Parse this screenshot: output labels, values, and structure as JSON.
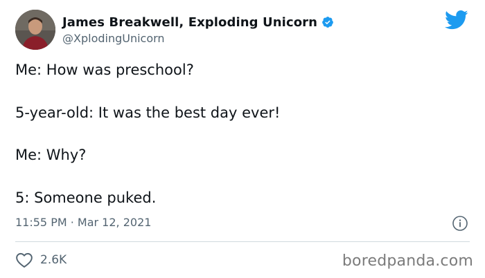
{
  "author": {
    "display_name": "James Breakwell, Exploding Unicorn",
    "handle": "@XplodingUnicorn",
    "verified": true
  },
  "tweet": {
    "lines": [
      "Me: How was preschool?",
      "5-year-old: It was the best day ever!",
      "Me: Why?",
      "5: Someone puked."
    ],
    "timestamp": "11:55 PM · Mar 12, 2021"
  },
  "actions": {
    "like_count": "2.6K",
    "like_icon": "heart-icon",
    "info_icon": "info-icon"
  },
  "watermark": "boredpanda.com",
  "colors": {
    "twitter_blue": "#1d9bf0",
    "text_primary": "#0f1419",
    "text_secondary": "#536471",
    "divider": "#cfd9de"
  }
}
